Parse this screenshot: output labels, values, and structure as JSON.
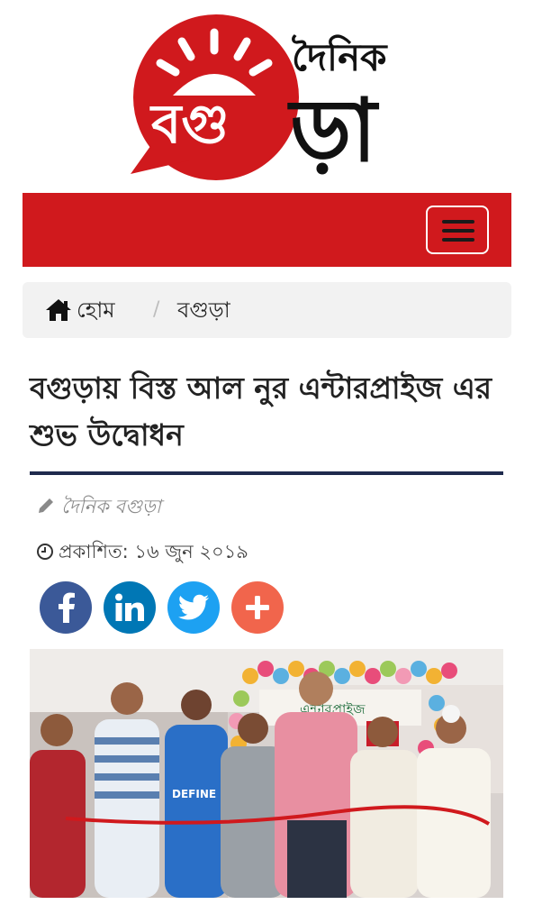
{
  "logo": {
    "brand_top": "দৈনিক",
    "brand_bottom": "ড়া",
    "brand_red": "বগু",
    "red_color": "#d0191d"
  },
  "nav": {
    "background": "#d0191d",
    "menu_icon": "hamburger-icon"
  },
  "breadcrumb": {
    "home_icon": "home-icon",
    "home_label": "হোম",
    "separator": "/",
    "current": "বগুড়া"
  },
  "article": {
    "title": "বগুড়ায় বিস্ত আল নুর এন্টারপ্রাইজ এর শুভ উদ্বোধন",
    "author_icon": "pencil-icon",
    "author": "দৈনিক বগুড়া",
    "date_icon": "clock-icon",
    "published": "প্রকাশিত: ১৬ জুন ২০১৯"
  },
  "share": [
    {
      "network": "facebook",
      "icon": "facebook-icon",
      "color": "#3b5998"
    },
    {
      "network": "linkedin",
      "icon": "linkedin-icon",
      "color": "#0077b5"
    },
    {
      "network": "twitter",
      "icon": "twitter-icon",
      "color": "#1da1f2"
    },
    {
      "network": "more",
      "icon": "plus-icon",
      "color": "#f1654c"
    }
  ],
  "photo": {
    "banner_text": "এন্টারপ্রাইজ",
    "shirt_text": "DEFINE"
  }
}
